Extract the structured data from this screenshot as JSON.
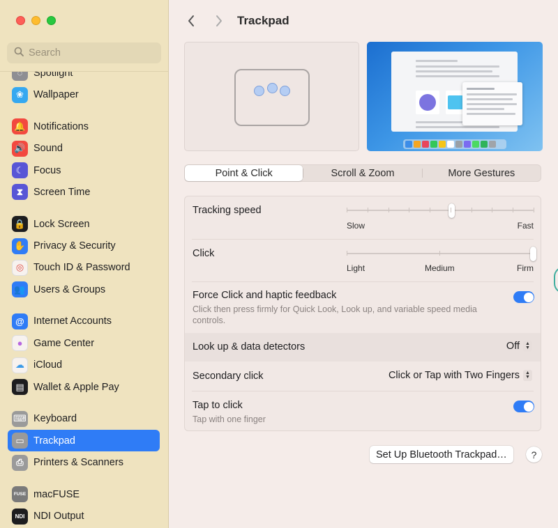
{
  "window": {
    "controls": [
      "close",
      "minimize",
      "zoom"
    ]
  },
  "search": {
    "placeholder": "Search",
    "icon": "magnifyingglass"
  },
  "sidebar": {
    "partial_item": {
      "label": "Spotlight",
      "icon": "spotlight-icon"
    },
    "groups": [
      [
        {
          "label": "Wallpaper",
          "icon": "wallpaper-icon",
          "color": "#35a8f0"
        }
      ],
      [
        {
          "label": "Notifications",
          "icon": "bell-icon",
          "color": "#f2493f"
        },
        {
          "label": "Sound",
          "icon": "speaker-icon",
          "color": "#f2493f"
        },
        {
          "label": "Focus",
          "icon": "moon-icon",
          "color": "#5856d6"
        },
        {
          "label": "Screen Time",
          "icon": "hourglass-icon",
          "color": "#5856d6"
        }
      ],
      [
        {
          "label": "Lock Screen",
          "icon": "lock-icon",
          "color": "#1d1d1f"
        },
        {
          "label": "Privacy & Security",
          "icon": "hand-icon",
          "color": "#2f7cf6"
        },
        {
          "label": "Touch ID & Password",
          "icon": "fingerprint-icon",
          "color": "#f7f2ef"
        },
        {
          "label": "Users & Groups",
          "icon": "users-icon",
          "color": "#2f7cf6"
        }
      ],
      [
        {
          "label": "Internet Accounts",
          "icon": "at-icon",
          "color": "#2f7cf6"
        },
        {
          "label": "Game Center",
          "icon": "game-center-icon",
          "color": "#f7f2ef"
        },
        {
          "label": "iCloud",
          "icon": "cloud-icon",
          "color": "#f7f2ef"
        },
        {
          "label": "Wallet & Apple Pay",
          "icon": "wallet-icon",
          "color": "#1d1d1f"
        }
      ],
      [
        {
          "label": "Keyboard",
          "icon": "keyboard-icon",
          "color": "#9a9a9a"
        },
        {
          "label": "Trackpad",
          "icon": "trackpad-icon",
          "color": "#9a9a9a",
          "active": true
        },
        {
          "label": "Printers & Scanners",
          "icon": "printer-icon",
          "color": "#9a9a9a"
        }
      ],
      [
        {
          "label": "macFUSE",
          "icon": "fuse-icon",
          "color": "#7a7a7a",
          "glyph": "FUSE"
        },
        {
          "label": "NDI Output",
          "icon": "ndi-icon",
          "color": "#1d1d1f",
          "glyph": "NDI"
        }
      ]
    ]
  },
  "header": {
    "title": "Trackpad",
    "back": "‹",
    "forward": "›"
  },
  "tabs": [
    {
      "label": "Point & Click",
      "active": true
    },
    {
      "label": "Scroll & Zoom",
      "active": false
    },
    {
      "label": "More Gestures",
      "active": false
    }
  ],
  "settings": {
    "tracking_speed": {
      "label": "Tracking speed",
      "min_label": "Slow",
      "max_label": "Fast",
      "ticks": 10,
      "value": 0.56
    },
    "click": {
      "label": "Click",
      "labels": [
        "Light",
        "Medium",
        "Firm"
      ],
      "value": 1.0
    },
    "force_click": {
      "label": "Force Click and haptic feedback",
      "description": "Click then press firmly for Quick Look, Look up, and variable speed media controls.",
      "enabled": true
    },
    "look_up": {
      "label": "Look up & data detectors",
      "value": "Off"
    },
    "secondary_click": {
      "label": "Secondary click",
      "value": "Click or Tap with Two Fingers"
    },
    "tap_to_click": {
      "label": "Tap to click",
      "description": "Tap with one finger",
      "enabled": true
    }
  },
  "buttons": {
    "bluetooth": "Set Up Bluetooth Trackpad…",
    "help": "?"
  },
  "colors": {
    "accent": "#2f7cf6",
    "sidebar_bg": "#efe3bf",
    "main_bg": "#f5ece9"
  }
}
